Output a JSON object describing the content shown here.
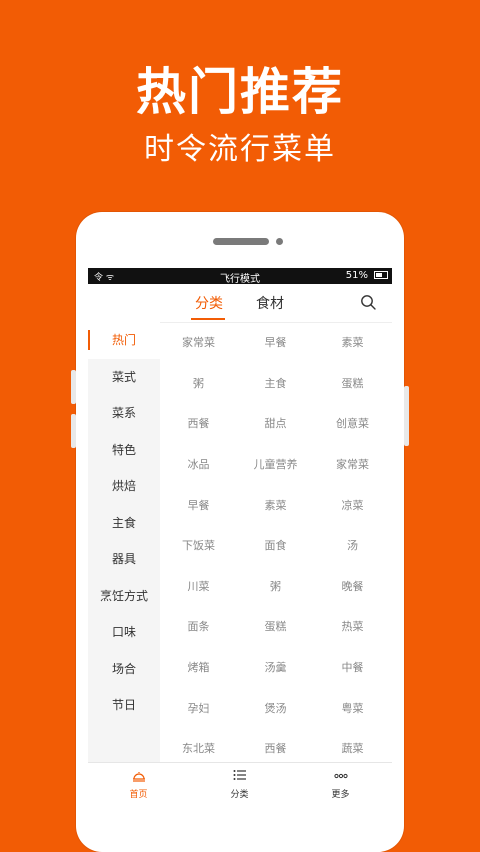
{
  "promo": {
    "headline": "热门推荐",
    "subline": "时令流行菜单"
  },
  "statusbar": {
    "signal": "令 ᯤ",
    "mode": "飞行模式",
    "battery": "51%"
  },
  "tabs": [
    {
      "label": "分类",
      "active": true
    },
    {
      "label": "食材",
      "active": false
    }
  ],
  "search_icon": "search-icon",
  "categories": [
    {
      "label": "热门",
      "active": true
    },
    {
      "label": "菜式"
    },
    {
      "label": "菜系"
    },
    {
      "label": "特色"
    },
    {
      "label": "烘焙"
    },
    {
      "label": "主食"
    },
    {
      "label": "器具"
    },
    {
      "label": "烹饪方式"
    },
    {
      "label": "口味"
    },
    {
      "label": "场合"
    },
    {
      "label": "节日"
    }
  ],
  "items": [
    [
      "家常菜",
      "早餐",
      "素菜"
    ],
    [
      "粥",
      "主食",
      "蛋糕"
    ],
    [
      "西餐",
      "甜点",
      "创意菜"
    ],
    [
      "冰品",
      "儿童营养",
      "家常菜"
    ],
    [
      "早餐",
      "素菜",
      "凉菜"
    ],
    [
      "下饭菜",
      "面食",
      "汤"
    ],
    [
      "川菜",
      "粥",
      "晚餐"
    ],
    [
      "面条",
      "蛋糕",
      "热菜"
    ],
    [
      "烤箱",
      "汤羹",
      "中餐"
    ],
    [
      "孕妇",
      "煲汤",
      "粤菜"
    ],
    [
      "东北菜",
      "西餐",
      "蔬菜"
    ]
  ],
  "bottomnav": [
    {
      "label": "首页",
      "icon": "home-icon",
      "active": true
    },
    {
      "label": "分类",
      "icon": "list-icon"
    },
    {
      "label": "更多",
      "icon": "more-icon"
    }
  ],
  "colors": {
    "accent": "#f25c05"
  }
}
